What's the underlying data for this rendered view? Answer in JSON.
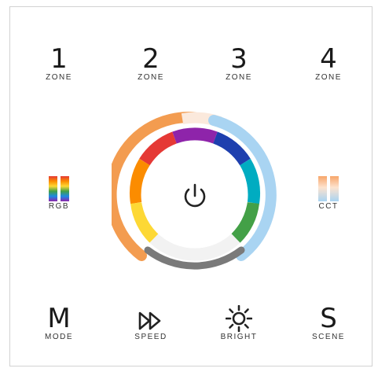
{
  "zones": [
    {
      "number": "1",
      "label": "ZONE"
    },
    {
      "number": "2",
      "label": "ZONE"
    },
    {
      "number": "3",
      "label": "ZONE"
    },
    {
      "number": "4",
      "label": "ZONE"
    }
  ],
  "left_control": {
    "label": "RGB",
    "icon": "rgb-stripes-icon"
  },
  "right_control": {
    "label": "CCT",
    "icon": "cct-stripes-icon"
  },
  "center": {
    "icon": "power-icon"
  },
  "bottom": [
    {
      "glyph": "M",
      "label": "MODE",
      "icon": "mode-icon"
    },
    {
      "label": "SPEED",
      "icon": "fast-forward-icon"
    },
    {
      "label": "BRIGHT",
      "icon": "sun-icon"
    },
    {
      "glyph": "S",
      "label": "SCENE",
      "icon": "scene-icon"
    }
  ],
  "colors": {
    "border": "#d2d2d2",
    "text": "#222222"
  }
}
